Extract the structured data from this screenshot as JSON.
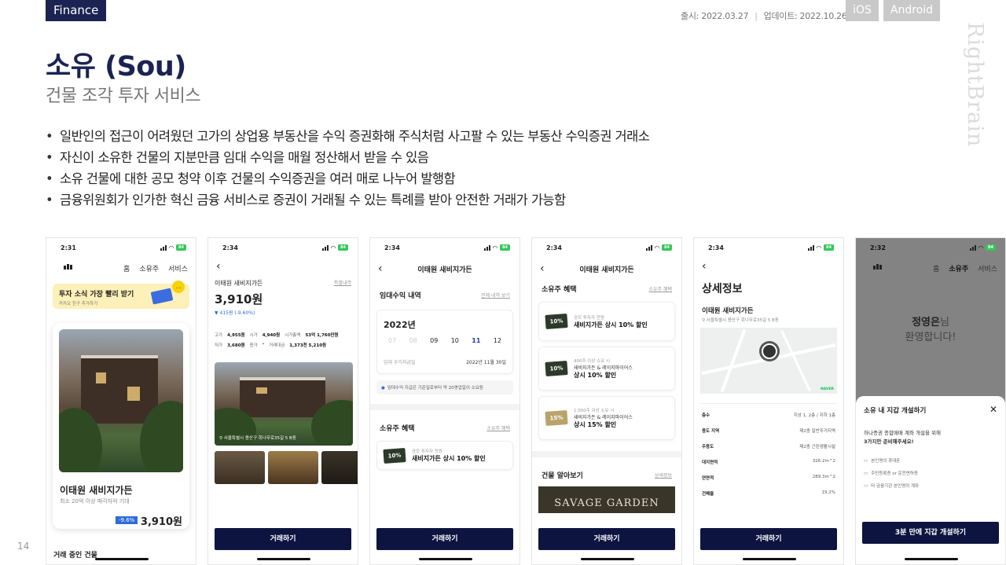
{
  "header": {
    "category": "Finance",
    "release": "출시: 2022.03.27",
    "update": "업데이트: 2022.10.26",
    "platforms": [
      "iOS",
      "Android"
    ],
    "brand": "RightBrain"
  },
  "title": "소유 (Sou)",
  "subtitle": "건물 조각 투자 서비스",
  "bullets": [
    "일반인의 접근이 어려웠던 고가의 상업용 부동산을 수익 증권화해 주식처럼 사고팔 수 있는 부동산 수익증권 거래소",
    "자신이 소유한 건물의 지분만큼 임대 수익을 매월 정산해서 받을 수 있음",
    "소유 건물에 대한 공모 청약 이후 건물의 수익증권을 여러 매로 나누어 발행함",
    "금융위원회가 인가한 혁신 금융 서비스로 증권이 거래될 수 있는 특례를 받아 안전한 거래가 가능함"
  ],
  "page_number": "14",
  "colors": {
    "navy": "#1b2352",
    "cta": "#0d1440",
    "accent_blue": "#2e6bd9"
  },
  "phones": {
    "p1": {
      "time": "2:31",
      "nav": [
        "홈",
        "소유주",
        "서비스"
      ],
      "banner_title": "투자 소식 가장 빨리 받기",
      "banner_sub": "카카오 친구 추가하기",
      "card_name": "이태원 새비지가든",
      "card_desc": "최소 20억 이상 매각차익 기대",
      "card_change": "-9.6%",
      "card_price": "3,910원",
      "footer": "거래 중인 건물"
    },
    "p2": {
      "time": "2:34",
      "name": "이태원 새비지가든",
      "link": "특별내역",
      "price": "3,910원",
      "change": "▼ 415원 (-9.60%)",
      "row1": [
        "고가",
        "4,955원",
        "시가",
        "4,940원",
        "시가총액",
        "53억 1,760만원"
      ],
      "row2": [
        "저가",
        "3,680원",
        "종가",
        "-",
        "거래대금",
        "1,373천 5,210원"
      ],
      "address": "서울특별시 용산구 회나무로35길 5 B동",
      "cta": "거래하기"
    },
    "p3": {
      "time": "2:34",
      "title": "이태원 새비지가든",
      "section": "임대수익 내역",
      "section_link": "전체 내역 보기",
      "year": "2022년",
      "months": [
        "07",
        "08",
        "09",
        "10",
        "11",
        "12"
      ],
      "due_label": "임대 수익지급일",
      "due_value": "2022년 11월 30일",
      "notice": "임대수익 지급은 기준일로부터 약 20영업일이 소요됨",
      "benefit_section": "소유주 혜택",
      "benefit_link": "소유주 혜택",
      "benefit_small": "공모 투자자 전원",
      "benefit_big": "새비지가든 상시 10% 할인",
      "coupon": "10%",
      "cta": "거래하기"
    },
    "p4": {
      "time": "2:34",
      "title": "이태원 새비지가든",
      "section": "소유주 혜택",
      "section_link": "소유주 혜택",
      "benefits": [
        {
          "coupon": "10%",
          "small": "공모 투자자 전원",
          "mid": "",
          "big": "새비지가든 상시 10% 할인"
        },
        {
          "coupon": "10%",
          "small": "400주 이상 소유 시",
          "mid": "새비지가든 & 레이지파이어스",
          "big": "상시 10% 할인"
        },
        {
          "coupon": "15%",
          "small": "1,000주 이상 소유 시",
          "mid": "새비지가든 & 레이지파이어스",
          "big": "상시 15% 할인"
        }
      ],
      "building_section": "건물 알아보기",
      "building_link": "상세정보",
      "banner_text": "SAVAGE GARDEN",
      "cta": "거래하기"
    },
    "p5": {
      "time": "2:34",
      "title": "상세정보",
      "name": "이태원 새비지가든",
      "address": "서울특별시 용산구 회나무로35길 5 B동",
      "map_credit": "NAVER",
      "rows": [
        [
          "층수",
          "지상 1, 2층 / 지하 1층"
        ],
        [
          "용도 지역",
          "제2종 일반주거지역"
        ],
        [
          "주용도",
          "제2종 근린생활시설"
        ],
        [
          "대지면적",
          "326.2m^2"
        ],
        [
          "연면적",
          "289.3m^2"
        ],
        [
          "건폐율",
          "19.2%"
        ]
      ],
      "cta": "거래하기"
    },
    "p6": {
      "time": "2:32",
      "nav": [
        "홈",
        "소유주",
        "서비스"
      ],
      "greet_name": "정영은",
      "greet_suffix": "님",
      "greet_line2": "환영합니다!",
      "sheet_title": "소유 내 지갑 개설하기",
      "intro1": "하나증권 종합매매 계좌 개설을 위해",
      "intro2": "3가지만 준비해주세요!",
      "reqs": [
        "본인명의 휴대폰",
        "주민등록증 or 운전면허증",
        "타 금융기관 본인명의 계좌"
      ],
      "cta": "3분 만에 지갑 개설하기"
    }
  }
}
